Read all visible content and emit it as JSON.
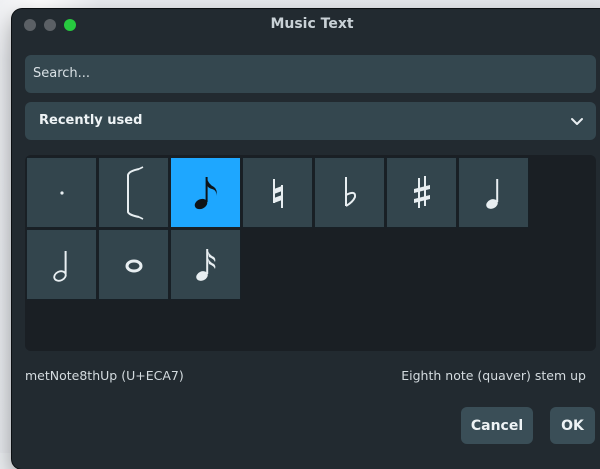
{
  "window": {
    "title": "Music Text"
  },
  "search": {
    "placeholder": "Search..."
  },
  "category": {
    "selected": "Recently used"
  },
  "symbols": [
    {
      "icon": "dot",
      "char": "·",
      "selected": false
    },
    {
      "icon": "bracket-icon",
      "char": "[",
      "selected": false
    },
    {
      "icon": "eighth-note-icon",
      "char": "♪",
      "selected": true
    },
    {
      "icon": "natural-icon",
      "char": "♮",
      "selected": false
    },
    {
      "icon": "flat-icon",
      "char": "♭",
      "selected": false
    },
    {
      "icon": "sharp-icon",
      "char": "♯",
      "selected": false
    },
    {
      "icon": "quarter-note-icon",
      "char": "♩",
      "selected": false
    },
    {
      "icon": "half-note-icon",
      "char": "𝅗𝅥",
      "selected": false
    },
    {
      "icon": "whole-note-icon",
      "char": "𝅝",
      "selected": false
    },
    {
      "icon": "sixteenth-note-icon",
      "char": "♬",
      "selected": false
    }
  ],
  "selection_info": {
    "name": "metNote8thUp (U+ECA7)",
    "description": "Eighth note (quaver) stem up"
  },
  "buttons": {
    "cancel": "Cancel",
    "ok": "OK"
  },
  "colors": {
    "accent": "#1ea7ff",
    "maximize": "#27c93f"
  }
}
